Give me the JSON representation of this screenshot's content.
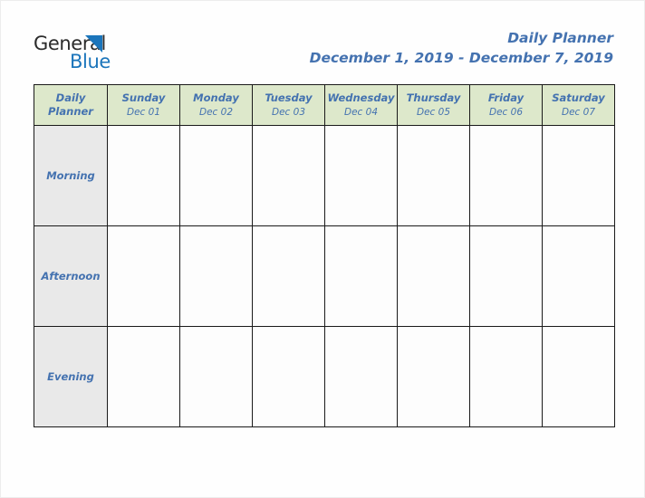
{
  "brand": {
    "name_part1": "General",
    "name_part2": "Blue",
    "triangle_color": "#1b75bb",
    "text_color": "#2b2b2b"
  },
  "header": {
    "title": "Daily Planner",
    "date_range": "December 1, 2019 - December 7, 2019",
    "accent_color": "#4472b0"
  },
  "table": {
    "corner": {
      "line1": "Daily",
      "line2": "Planner"
    },
    "header_background": "#dde8cb",
    "row_label_background": "#e9e9e9",
    "cell_background": "#fdfdfd",
    "border_color": "#1a1a1a",
    "columns": [
      {
        "day": "Sunday",
        "date": "Dec 01"
      },
      {
        "day": "Monday",
        "date": "Dec 02"
      },
      {
        "day": "Tuesday",
        "date": "Dec 03"
      },
      {
        "day": "Wednesday",
        "date": "Dec 04"
      },
      {
        "day": "Thursday",
        "date": "Dec 05"
      },
      {
        "day": "Friday",
        "date": "Dec 06"
      },
      {
        "day": "Saturday",
        "date": "Dec 07"
      }
    ],
    "rows": [
      {
        "label": "Morning",
        "cells": [
          "",
          "",
          "",
          "",
          "",
          "",
          ""
        ]
      },
      {
        "label": "Afternoon",
        "cells": [
          "",
          "",
          "",
          "",
          "",
          "",
          ""
        ]
      },
      {
        "label": "Evening",
        "cells": [
          "",
          "",
          "",
          "",
          "",
          "",
          ""
        ]
      }
    ]
  }
}
